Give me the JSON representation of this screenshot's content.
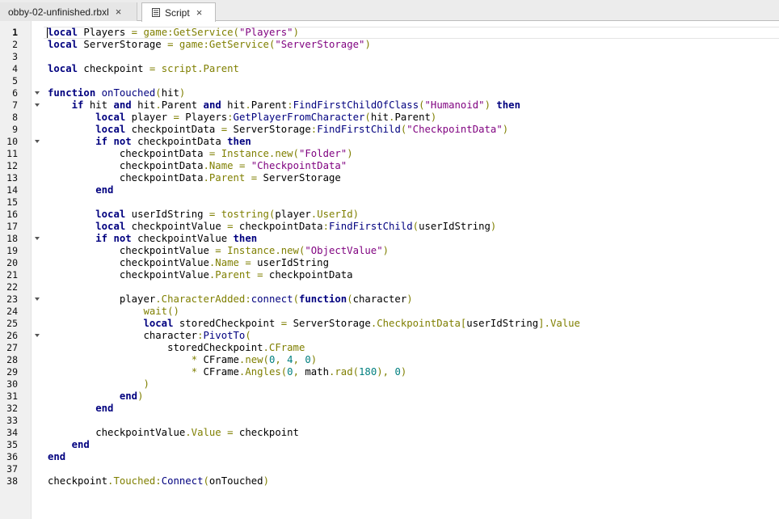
{
  "tabs": [
    {
      "label": "obby-02-unfinished.rbxl",
      "active": false,
      "icon": "none"
    },
    {
      "label": "Script",
      "active": true,
      "icon": "script-icon"
    }
  ],
  "close_glyph": "×",
  "current_line": 1,
  "folds": [
    6,
    7,
    10,
    18,
    23,
    26
  ],
  "code_lines": [
    [
      [
        "k",
        "local"
      ],
      [
        "t",
        " Players "
      ],
      [
        "o",
        "="
      ],
      [
        "t",
        " "
      ],
      [
        "p",
        "game:GetService("
      ],
      [
        "s",
        "\"Players\""
      ],
      [
        "p",
        ")"
      ]
    ],
    [
      [
        "k",
        "local"
      ],
      [
        "t",
        " ServerStorage "
      ],
      [
        "o",
        "="
      ],
      [
        "t",
        " "
      ],
      [
        "p",
        "game:GetService("
      ],
      [
        "s",
        "\"ServerStorage\""
      ],
      [
        "p",
        ")"
      ]
    ],
    [],
    [
      [
        "k",
        "local"
      ],
      [
        "t",
        " checkpoint "
      ],
      [
        "o",
        "="
      ],
      [
        "t",
        " "
      ],
      [
        "p",
        "script.Parent"
      ]
    ],
    [],
    [
      [
        "k",
        "function"
      ],
      [
        "t",
        " "
      ],
      [
        "b",
        "onTouched"
      ],
      [
        "p",
        "("
      ],
      [
        "t",
        "hit"
      ],
      [
        "p",
        ")"
      ]
    ],
    [
      [
        "t",
        "    "
      ],
      [
        "k",
        "if"
      ],
      [
        "t",
        " hit "
      ],
      [
        "k",
        "and"
      ],
      [
        "t",
        " hit"
      ],
      [
        "p",
        "."
      ],
      [
        "t",
        "Parent "
      ],
      [
        "k",
        "and"
      ],
      [
        "t",
        " hit"
      ],
      [
        "p",
        "."
      ],
      [
        "t",
        "Parent"
      ],
      [
        "p",
        ":"
      ],
      [
        "b",
        "FindFirstChildOfClass"
      ],
      [
        "p",
        "("
      ],
      [
        "s",
        "\"Humanoid\""
      ],
      [
        "p",
        ")"
      ],
      [
        "t",
        " "
      ],
      [
        "k",
        "then"
      ]
    ],
    [
      [
        "t",
        "        "
      ],
      [
        "k",
        "local"
      ],
      [
        "t",
        " player "
      ],
      [
        "o",
        "="
      ],
      [
        "t",
        " Players"
      ],
      [
        "p",
        ":"
      ],
      [
        "b",
        "GetPlayerFromCharacter"
      ],
      [
        "p",
        "("
      ],
      [
        "t",
        "hit"
      ],
      [
        "p",
        "."
      ],
      [
        "t",
        "Parent"
      ],
      [
        "p",
        ")"
      ]
    ],
    [
      [
        "t",
        "        "
      ],
      [
        "k",
        "local"
      ],
      [
        "t",
        " checkpointData "
      ],
      [
        "o",
        "="
      ],
      [
        "t",
        " ServerStorage"
      ],
      [
        "p",
        ":"
      ],
      [
        "b",
        "FindFirstChild"
      ],
      [
        "p",
        "("
      ],
      [
        "s",
        "\"CheckpointData\""
      ],
      [
        "p",
        ")"
      ]
    ],
    [
      [
        "t",
        "        "
      ],
      [
        "k",
        "if"
      ],
      [
        "t",
        " "
      ],
      [
        "k",
        "not"
      ],
      [
        "t",
        " checkpointData "
      ],
      [
        "k",
        "then"
      ]
    ],
    [
      [
        "t",
        "            checkpointData "
      ],
      [
        "o",
        "="
      ],
      [
        "t",
        " "
      ],
      [
        "p",
        "Instance.new("
      ],
      [
        "s",
        "\"Folder\""
      ],
      [
        "p",
        ")"
      ]
    ],
    [
      [
        "t",
        "            checkpointData"
      ],
      [
        "p",
        ".Name"
      ],
      [
        "t",
        " "
      ],
      [
        "o",
        "="
      ],
      [
        "t",
        " "
      ],
      [
        "s",
        "\"CheckpointData\""
      ]
    ],
    [
      [
        "t",
        "            checkpointData"
      ],
      [
        "p",
        ".Parent"
      ],
      [
        "t",
        " "
      ],
      [
        "o",
        "="
      ],
      [
        "t",
        " ServerStorage"
      ]
    ],
    [
      [
        "t",
        "        "
      ],
      [
        "k",
        "end"
      ]
    ],
    [],
    [
      [
        "t",
        "        "
      ],
      [
        "k",
        "local"
      ],
      [
        "t",
        " userIdString "
      ],
      [
        "o",
        "="
      ],
      [
        "t",
        " "
      ],
      [
        "p",
        "tostring("
      ],
      [
        "t",
        "player"
      ],
      [
        "p",
        ".UserId)"
      ]
    ],
    [
      [
        "t",
        "        "
      ],
      [
        "k",
        "local"
      ],
      [
        "t",
        " checkpointValue "
      ],
      [
        "o",
        "="
      ],
      [
        "t",
        " checkpointData"
      ],
      [
        "p",
        ":"
      ],
      [
        "b",
        "FindFirstChild"
      ],
      [
        "p",
        "("
      ],
      [
        "t",
        "userIdString"
      ],
      [
        "p",
        ")"
      ]
    ],
    [
      [
        "t",
        "        "
      ],
      [
        "k",
        "if"
      ],
      [
        "t",
        " "
      ],
      [
        "k",
        "not"
      ],
      [
        "t",
        " checkpointValue "
      ],
      [
        "k",
        "then"
      ]
    ],
    [
      [
        "t",
        "            checkpointValue "
      ],
      [
        "o",
        "="
      ],
      [
        "t",
        " "
      ],
      [
        "p",
        "Instance.new("
      ],
      [
        "s",
        "\"ObjectValue\""
      ],
      [
        "p",
        ")"
      ]
    ],
    [
      [
        "t",
        "            checkpointValue"
      ],
      [
        "p",
        ".Name"
      ],
      [
        "t",
        " "
      ],
      [
        "o",
        "="
      ],
      [
        "t",
        " userIdString"
      ]
    ],
    [
      [
        "t",
        "            checkpointValue"
      ],
      [
        "p",
        ".Parent"
      ],
      [
        "t",
        " "
      ],
      [
        "o",
        "="
      ],
      [
        "t",
        " checkpointData"
      ]
    ],
    [],
    [
      [
        "t",
        "            player"
      ],
      [
        "p",
        ".CharacterAdded:"
      ],
      [
        "b",
        "connect"
      ],
      [
        "p",
        "("
      ],
      [
        "k",
        "function"
      ],
      [
        "p",
        "("
      ],
      [
        "t",
        "character"
      ],
      [
        "p",
        ")"
      ]
    ],
    [
      [
        "t",
        "                "
      ],
      [
        "p",
        "wait()"
      ]
    ],
    [
      [
        "t",
        "                "
      ],
      [
        "k",
        "local"
      ],
      [
        "t",
        " storedCheckpoint "
      ],
      [
        "o",
        "="
      ],
      [
        "t",
        " ServerStorage"
      ],
      [
        "p",
        ".CheckpointData["
      ],
      [
        "t",
        "userIdString"
      ],
      [
        "p",
        "].Value"
      ]
    ],
    [
      [
        "t",
        "                character"
      ],
      [
        "p",
        ":"
      ],
      [
        "b",
        "PivotTo"
      ],
      [
        "p",
        "("
      ]
    ],
    [
      [
        "t",
        "                    storedCheckpoint"
      ],
      [
        "p",
        ".CFrame"
      ]
    ],
    [
      [
        "t",
        "                        "
      ],
      [
        "o",
        "*"
      ],
      [
        "t",
        " CFrame"
      ],
      [
        "p",
        ".new("
      ],
      [
        "n",
        "0"
      ],
      [
        "p",
        ", "
      ],
      [
        "n",
        "4"
      ],
      [
        "p",
        ", "
      ],
      [
        "n",
        "0"
      ],
      [
        "p",
        ")"
      ]
    ],
    [
      [
        "t",
        "                        "
      ],
      [
        "o",
        "*"
      ],
      [
        "t",
        " CFrame"
      ],
      [
        "p",
        ".Angles("
      ],
      [
        "n",
        "0"
      ],
      [
        "p",
        ", "
      ],
      [
        "t",
        "math"
      ],
      [
        "p",
        ".rad("
      ],
      [
        "n",
        "180"
      ],
      [
        "p",
        "), "
      ],
      [
        "n",
        "0"
      ],
      [
        "p",
        ")"
      ]
    ],
    [
      [
        "t",
        "                "
      ],
      [
        "p",
        ")"
      ]
    ],
    [
      [
        "t",
        "            "
      ],
      [
        "k",
        "end"
      ],
      [
        "p",
        ")"
      ]
    ],
    [
      [
        "t",
        "        "
      ],
      [
        "k",
        "end"
      ]
    ],
    [],
    [
      [
        "t",
        "        checkpointValue"
      ],
      [
        "p",
        ".Value"
      ],
      [
        "t",
        " "
      ],
      [
        "o",
        "="
      ],
      [
        "t",
        " checkpoint"
      ]
    ],
    [
      [
        "t",
        "    "
      ],
      [
        "k",
        "end"
      ]
    ],
    [
      [
        "k",
        "end"
      ]
    ],
    [],
    [
      [
        "t",
        "checkpoint"
      ],
      [
        "p",
        ".Touched:"
      ],
      [
        "b",
        "Connect"
      ],
      [
        "p",
        "("
      ],
      [
        "t",
        "onTouched"
      ],
      [
        "p",
        ")"
      ]
    ]
  ]
}
